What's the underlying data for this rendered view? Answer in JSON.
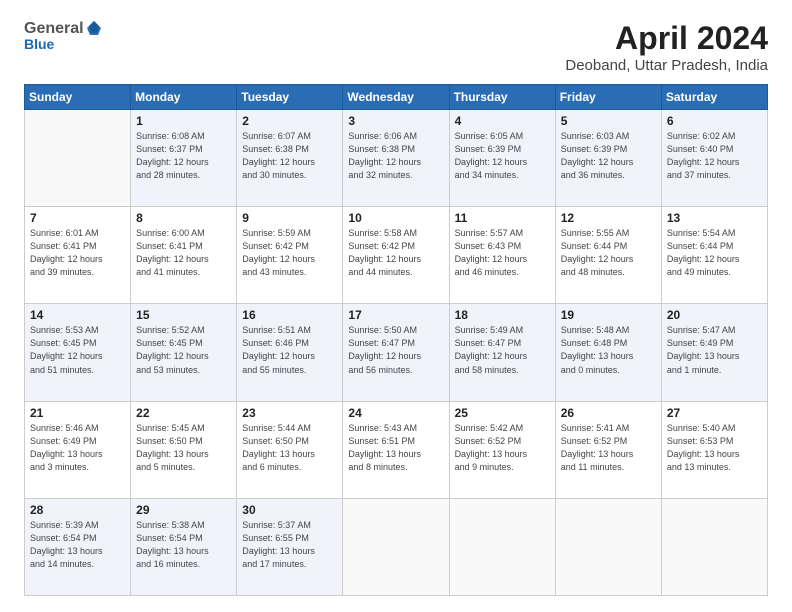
{
  "header": {
    "logo_general": "General",
    "logo_blue": "Blue",
    "title": "April 2024",
    "subtitle": "Deoband, Uttar Pradesh, India"
  },
  "days_of_week": [
    "Sunday",
    "Monday",
    "Tuesday",
    "Wednesday",
    "Thursday",
    "Friday",
    "Saturday"
  ],
  "weeks": [
    [
      {
        "day": "",
        "info": ""
      },
      {
        "day": "1",
        "info": "Sunrise: 6:08 AM\nSunset: 6:37 PM\nDaylight: 12 hours\nand 28 minutes."
      },
      {
        "day": "2",
        "info": "Sunrise: 6:07 AM\nSunset: 6:38 PM\nDaylight: 12 hours\nand 30 minutes."
      },
      {
        "day": "3",
        "info": "Sunrise: 6:06 AM\nSunset: 6:38 PM\nDaylight: 12 hours\nand 32 minutes."
      },
      {
        "day": "4",
        "info": "Sunrise: 6:05 AM\nSunset: 6:39 PM\nDaylight: 12 hours\nand 34 minutes."
      },
      {
        "day": "5",
        "info": "Sunrise: 6:03 AM\nSunset: 6:39 PM\nDaylight: 12 hours\nand 36 minutes."
      },
      {
        "day": "6",
        "info": "Sunrise: 6:02 AM\nSunset: 6:40 PM\nDaylight: 12 hours\nand 37 minutes."
      }
    ],
    [
      {
        "day": "7",
        "info": "Sunrise: 6:01 AM\nSunset: 6:41 PM\nDaylight: 12 hours\nand 39 minutes."
      },
      {
        "day": "8",
        "info": "Sunrise: 6:00 AM\nSunset: 6:41 PM\nDaylight: 12 hours\nand 41 minutes."
      },
      {
        "day": "9",
        "info": "Sunrise: 5:59 AM\nSunset: 6:42 PM\nDaylight: 12 hours\nand 43 minutes."
      },
      {
        "day": "10",
        "info": "Sunrise: 5:58 AM\nSunset: 6:42 PM\nDaylight: 12 hours\nand 44 minutes."
      },
      {
        "day": "11",
        "info": "Sunrise: 5:57 AM\nSunset: 6:43 PM\nDaylight: 12 hours\nand 46 minutes."
      },
      {
        "day": "12",
        "info": "Sunrise: 5:55 AM\nSunset: 6:44 PM\nDaylight: 12 hours\nand 48 minutes."
      },
      {
        "day": "13",
        "info": "Sunrise: 5:54 AM\nSunset: 6:44 PM\nDaylight: 12 hours\nand 49 minutes."
      }
    ],
    [
      {
        "day": "14",
        "info": "Sunrise: 5:53 AM\nSunset: 6:45 PM\nDaylight: 12 hours\nand 51 minutes."
      },
      {
        "day": "15",
        "info": "Sunrise: 5:52 AM\nSunset: 6:45 PM\nDaylight: 12 hours\nand 53 minutes."
      },
      {
        "day": "16",
        "info": "Sunrise: 5:51 AM\nSunset: 6:46 PM\nDaylight: 12 hours\nand 55 minutes."
      },
      {
        "day": "17",
        "info": "Sunrise: 5:50 AM\nSunset: 6:47 PM\nDaylight: 12 hours\nand 56 minutes."
      },
      {
        "day": "18",
        "info": "Sunrise: 5:49 AM\nSunset: 6:47 PM\nDaylight: 12 hours\nand 58 minutes."
      },
      {
        "day": "19",
        "info": "Sunrise: 5:48 AM\nSunset: 6:48 PM\nDaylight: 13 hours\nand 0 minutes."
      },
      {
        "day": "20",
        "info": "Sunrise: 5:47 AM\nSunset: 6:49 PM\nDaylight: 13 hours\nand 1 minute."
      }
    ],
    [
      {
        "day": "21",
        "info": "Sunrise: 5:46 AM\nSunset: 6:49 PM\nDaylight: 13 hours\nand 3 minutes."
      },
      {
        "day": "22",
        "info": "Sunrise: 5:45 AM\nSunset: 6:50 PM\nDaylight: 13 hours\nand 5 minutes."
      },
      {
        "day": "23",
        "info": "Sunrise: 5:44 AM\nSunset: 6:50 PM\nDaylight: 13 hours\nand 6 minutes."
      },
      {
        "day": "24",
        "info": "Sunrise: 5:43 AM\nSunset: 6:51 PM\nDaylight: 13 hours\nand 8 minutes."
      },
      {
        "day": "25",
        "info": "Sunrise: 5:42 AM\nSunset: 6:52 PM\nDaylight: 13 hours\nand 9 minutes."
      },
      {
        "day": "26",
        "info": "Sunrise: 5:41 AM\nSunset: 6:52 PM\nDaylight: 13 hours\nand 11 minutes."
      },
      {
        "day": "27",
        "info": "Sunrise: 5:40 AM\nSunset: 6:53 PM\nDaylight: 13 hours\nand 13 minutes."
      }
    ],
    [
      {
        "day": "28",
        "info": "Sunrise: 5:39 AM\nSunset: 6:54 PM\nDaylight: 13 hours\nand 14 minutes."
      },
      {
        "day": "29",
        "info": "Sunrise: 5:38 AM\nSunset: 6:54 PM\nDaylight: 13 hours\nand 16 minutes."
      },
      {
        "day": "30",
        "info": "Sunrise: 5:37 AM\nSunset: 6:55 PM\nDaylight: 13 hours\nand 17 minutes."
      },
      {
        "day": "",
        "info": ""
      },
      {
        "day": "",
        "info": ""
      },
      {
        "day": "",
        "info": ""
      },
      {
        "day": "",
        "info": ""
      }
    ]
  ]
}
